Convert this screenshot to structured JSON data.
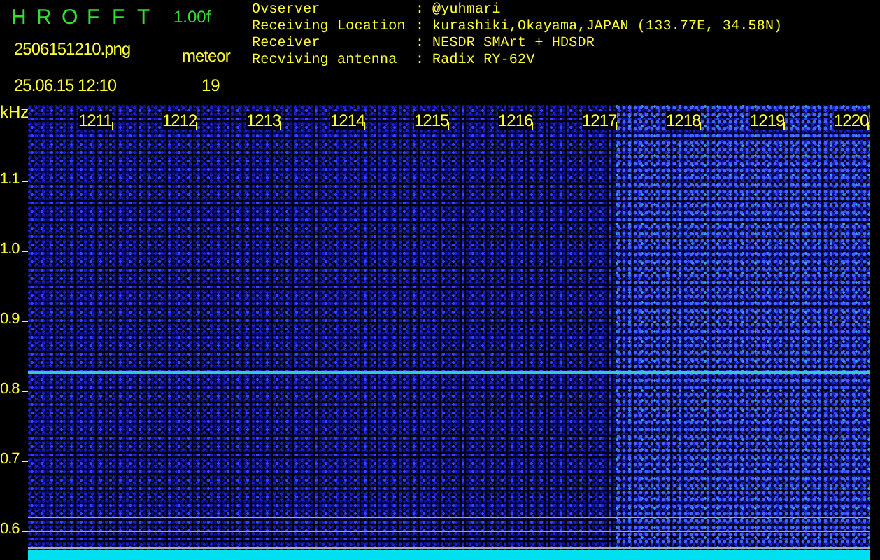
{
  "logo": {
    "letters": [
      "H",
      "R",
      "O",
      "F",
      "F",
      "T"
    ],
    "version": "1.00f"
  },
  "file": {
    "name": "2506151210.png",
    "datetime": "25.06.15 12:10"
  },
  "meteor": {
    "label": "meteor",
    "count": "19"
  },
  "info": [
    {
      "label": "Ovserver",
      "separator": ":",
      "value": "@yuhmari"
    },
    {
      "label": "Receiving Location",
      "separator": ":",
      "value": "kurashiki,Okayama,JAPAN (133.77E, 34.58N)"
    },
    {
      "label": "Receiver",
      "separator": ":",
      "value": "NESDR SMArt + HDSDR"
    },
    {
      "label": "Recviving antenna",
      "separator": ":",
      "value": "Radix RY-62V"
    }
  ],
  "spectrogram": {
    "unit": "kHz",
    "x_labels": [
      "1211",
      "1212",
      "1213",
      "1214",
      "1215",
      "1216",
      "1217",
      "1218",
      "1219",
      "1220"
    ],
    "y_labels": [
      "1.1",
      "1.0",
      "0.9",
      "0.8",
      "0.7",
      "0.6"
    ]
  }
}
